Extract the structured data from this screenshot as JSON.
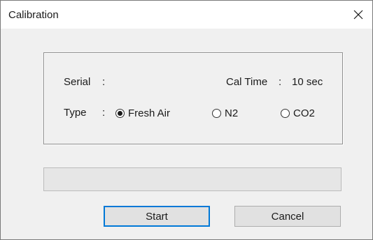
{
  "window": {
    "title": "Calibration"
  },
  "form": {
    "serial_label": "Serial",
    "serial_colon": ":",
    "serial_value": "",
    "cal_time_label": "Cal Time",
    "cal_time_colon": ":",
    "cal_time_value": "10 sec",
    "type_label": "Type",
    "type_colon": ":",
    "type_options": [
      {
        "label": "Fresh Air",
        "selected": true
      },
      {
        "label": "N2",
        "selected": false
      },
      {
        "label": "CO2",
        "selected": false
      }
    ]
  },
  "progress": {
    "value": 0
  },
  "buttons": {
    "start_label": "Start",
    "cancel_label": "Cancel"
  },
  "icons": {
    "close": "close-icon"
  },
  "colors": {
    "default_button_border": "#0078d7",
    "progress_fill": "#06b025"
  }
}
